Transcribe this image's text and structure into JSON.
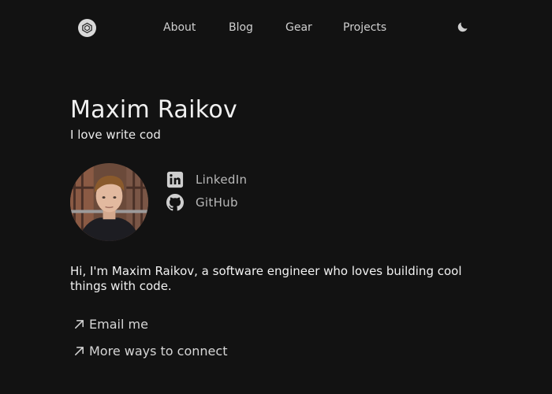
{
  "header": {
    "nav": [
      {
        "label": "About"
      },
      {
        "label": "Blog"
      },
      {
        "label": "Gear"
      },
      {
        "label": "Projects"
      }
    ]
  },
  "hero": {
    "name": "Maxim Raikov",
    "tagline": "I love write cod"
  },
  "social": [
    {
      "label": "LinkedIn",
      "icon": "linkedin-icon"
    },
    {
      "label": "GitHub",
      "icon": "github-icon"
    }
  ],
  "bio": "Hi, I'm Maxim Raikov, a software engineer who loves building cool things with code.",
  "links": [
    {
      "label": "Email me",
      "icon": "arrow-up-right-icon"
    },
    {
      "label": "More ways to connect",
      "icon": "arrow-up-right-icon"
    }
  ],
  "colors": {
    "background": "#121212",
    "text": "#e8e8e8",
    "muted": "#b9b9b9"
  }
}
